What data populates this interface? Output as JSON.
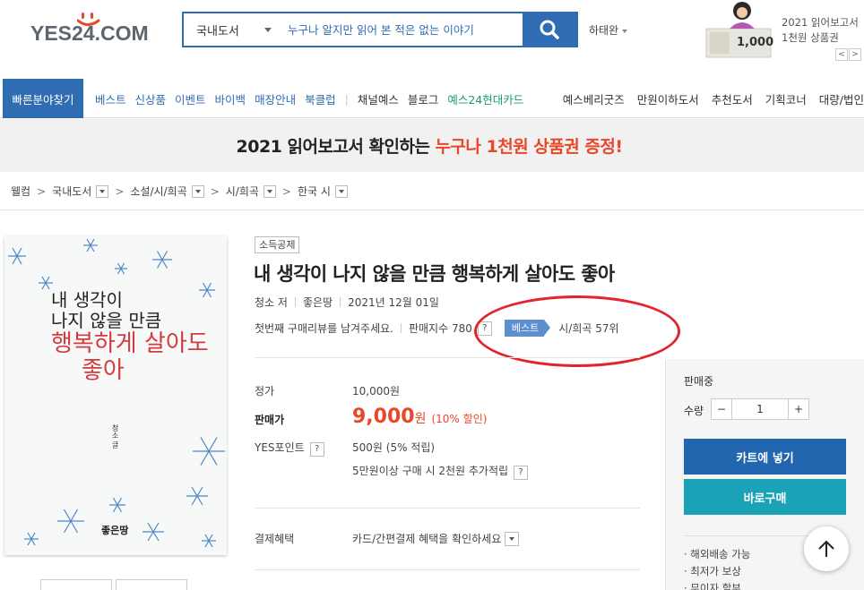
{
  "header": {
    "logo": "YES24.COM",
    "search": {
      "category": "국내도서",
      "placeholder": "누구나 알지만 읽어 본 적은 없는 이야기"
    },
    "user": "하태완",
    "promo": {
      "line1": "2021 읽어보고서",
      "line2": "1천원 상품권",
      "voucher_amount": "1,000",
      "prev": "<",
      "next": ">"
    }
  },
  "nav": {
    "quick": "빠른분야찾기",
    "items": [
      "베스트",
      "신상품",
      "이벤트",
      "바이백",
      "매장안내",
      "북클럽"
    ],
    "separator": "|",
    "items2": [
      "채널예스",
      "블로그"
    ],
    "card": "예스24현대카드",
    "right": [
      "예스베리굿즈",
      "만원이하도서",
      "추천도서",
      "기획코너",
      "대량/법인"
    ]
  },
  "banner": {
    "before": "2021 읽어보고서 확인하는",
    "accent": "누구나 1천원 상품권 증정!"
  },
  "breadcrumb": [
    "웰컴",
    "국내도서",
    "소설/시/희곡",
    "시/희곡",
    "한국 시"
  ],
  "book": {
    "badge": "소득공제",
    "title": "내 생각이 나지 않을 만큼 행복하게 살아도 좋아",
    "author": "청소 저",
    "publisher": "좋은땅",
    "date": "2021년 12월 01일",
    "review_prompt": "첫번째 구매리뷰를 남겨주세요.",
    "sales_index_label": "판매지수 780",
    "help": "?",
    "best_label": "베스트",
    "rank": "시/희곡 57위",
    "cover": {
      "line1": "내 생각이",
      "line2": "나지 않을 만큼",
      "line3": "행복하게 살아도",
      "line4": "좋아",
      "author_vertical": "청소 글",
      "publisher": "좋은땅"
    }
  },
  "price": {
    "list_label": "정가",
    "list_value": "10,000원",
    "sale_label": "판매가",
    "sale_value": "9,000",
    "sale_unit": "원",
    "discount": "(10% 할인)",
    "points_label": "YES포인트",
    "points_value": "500원 (5% 적립)",
    "extra_points": "5만원이상 구매 시 2천원 추가적립",
    "payment_label": "결제혜택",
    "payment_value": "카드/간편결제 혜택을 확인하세요"
  },
  "panel": {
    "status": "판매중",
    "qty_label": "수량",
    "minus": "−",
    "qty": "1",
    "plus": "+",
    "cart_button": "카트에 넣기",
    "buy_button": "바로구매",
    "benefits": [
      "· 해외배송 가능",
      "· 최저가 보상",
      "· 무이자 할부"
    ]
  },
  "colors": {
    "brand": "#2f6cb3",
    "accent": "#e8472a",
    "cart": "#2166af",
    "buy": "#1ba2b6",
    "annotation": "#e3242b"
  }
}
